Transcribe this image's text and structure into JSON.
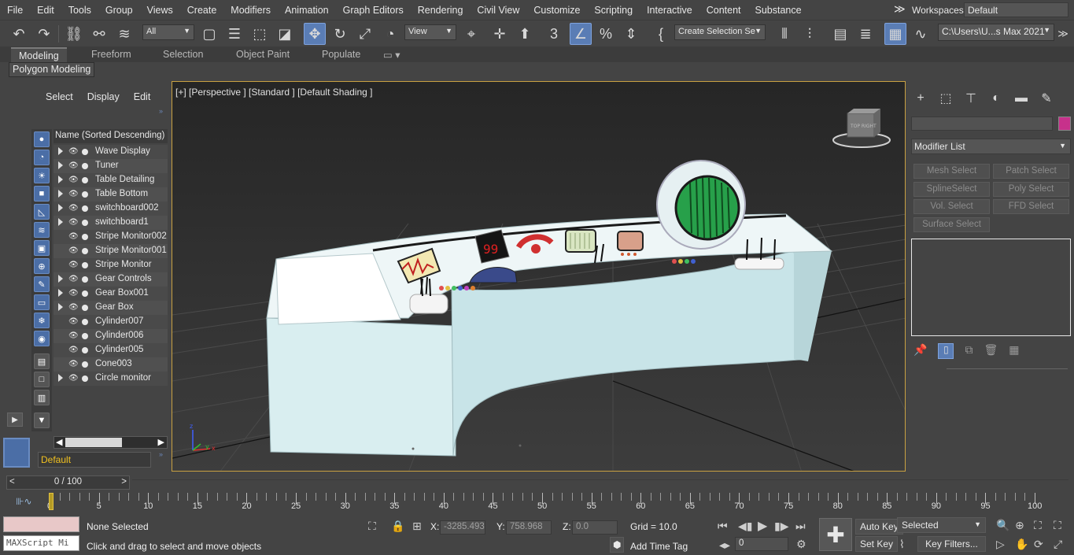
{
  "menu": [
    "File",
    "Edit",
    "Tools",
    "Group",
    "Views",
    "Create",
    "Modifiers",
    "Animation",
    "Graph Editors",
    "Rendering",
    "Civil View",
    "Customize",
    "Scripting",
    "Interactive",
    "Content",
    "Substance"
  ],
  "workspaces": {
    "label": "Workspaces:",
    "value": "Default"
  },
  "toolbar": {
    "filter_value": "All",
    "refcoord_value": "View",
    "selection_set_placeholder": "Create Selection Se",
    "project_path": "C:\\Users\\U...s Max 2021"
  },
  "ribbon": {
    "tabs": [
      "Modeling",
      "Freeform",
      "Selection",
      "Object Paint",
      "Populate"
    ],
    "active_tab": "Modeling",
    "panel_label": "Polygon Modeling"
  },
  "explorer": {
    "menu": [
      "Select",
      "Display",
      "Edit"
    ],
    "column_header": "Name (Sorted Descending)",
    "items": [
      {
        "name": "Wave Display",
        "expandable": true
      },
      {
        "name": "Tuner",
        "expandable": true
      },
      {
        "name": "Table Detailing",
        "expandable": true
      },
      {
        "name": "Table Bottom",
        "expandable": true
      },
      {
        "name": "switchboard002",
        "expandable": true
      },
      {
        "name": "switchboard1",
        "expandable": true
      },
      {
        "name": "Stripe Monitor002",
        "expandable": false
      },
      {
        "name": "Stripe Monitor001",
        "expandable": false
      },
      {
        "name": "Stripe Monitor",
        "expandable": false
      },
      {
        "name": "Gear Controls",
        "expandable": true
      },
      {
        "name": "Gear Box001",
        "expandable": true
      },
      {
        "name": "Gear Box",
        "expandable": true
      },
      {
        "name": "Cylinder007",
        "expandable": false
      },
      {
        "name": "Cylinder006",
        "expandable": false
      },
      {
        "name": "Cylinder005",
        "expandable": false
      },
      {
        "name": "Cone003",
        "expandable": false
      },
      {
        "name": "Circle monitor",
        "expandable": true
      }
    ],
    "layer": "Default"
  },
  "viewport": {
    "label": "[+] [Perspective ] [Standard ] [Default Shading ]",
    "viewcube_text": "TOP RIGHT"
  },
  "command_panel": {
    "modifier_list": "Modifier List",
    "buttons": [
      "Mesh Select",
      "Patch Select",
      "SplineSelect",
      "Poly Select",
      "Vol. Select",
      "FFD Select",
      "Surface Select"
    ],
    "swatch_color": "#c7318b"
  },
  "timeslider": {
    "value": "0 / 100"
  },
  "trackbar": {
    "labels": [
      "0",
      "5",
      "10",
      "15",
      "20",
      "25",
      "30",
      "35",
      "40",
      "45",
      "50",
      "55",
      "60",
      "65",
      "70",
      "75",
      "80",
      "85",
      "90",
      "95",
      "100"
    ]
  },
  "status": {
    "script_placeholder": "MAXScript Mi",
    "selection": "None Selected",
    "prompt": "Click and drag to select and move objects",
    "x_label": "X:",
    "x_value": "-3285.493",
    "y_label": "Y:",
    "y_value": "758.968",
    "z_label": "Z:",
    "z_value": "0.0",
    "grid": "Grid = 10.0",
    "add_time_tag": "Add Time Tag",
    "auto_key": "Auto Key",
    "set_key": "Set Key",
    "selected_dropdown": "Selected",
    "key_filters": "Key Filters...",
    "frame_value": "0"
  }
}
